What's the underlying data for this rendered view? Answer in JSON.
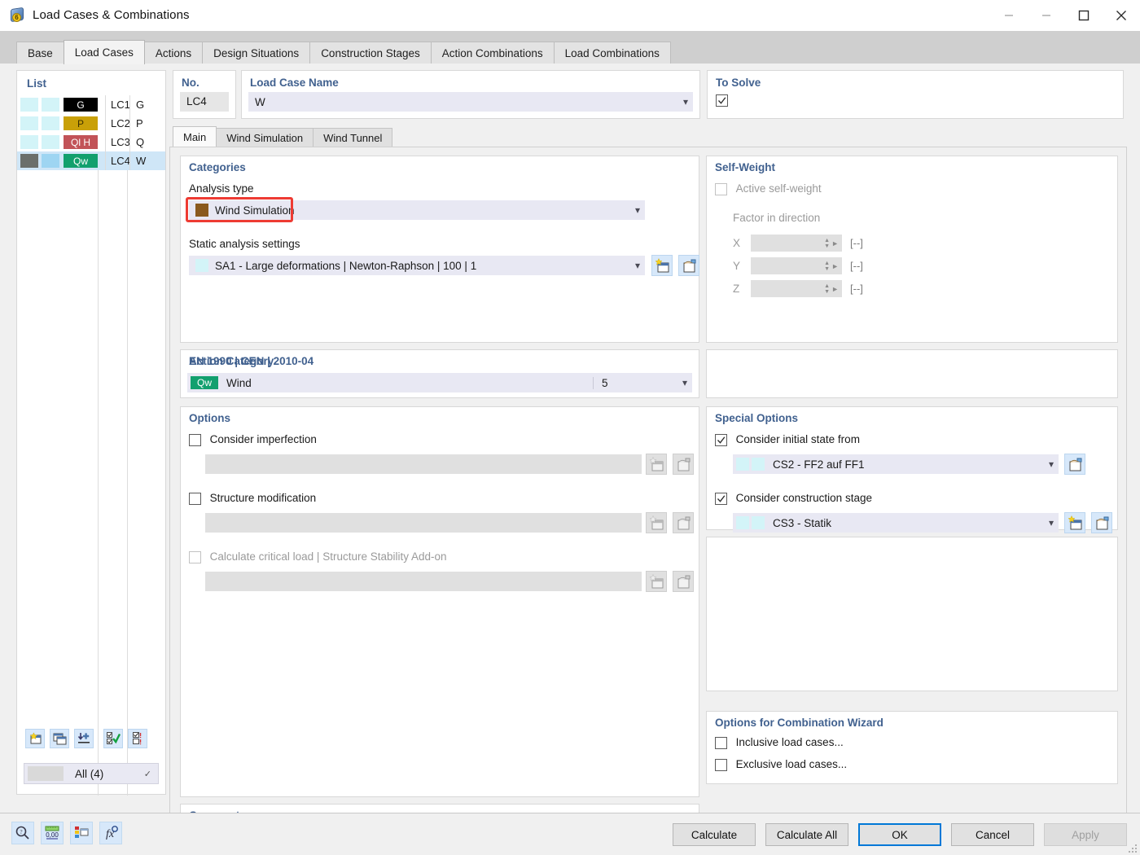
{
  "window": {
    "title": "Load Cases & Combinations",
    "icon": "app-cube-icon",
    "controls": {
      "restore_down": "minimize-icon",
      "minimize": "minimize-icon",
      "maximize": "maximize-icon",
      "close": "close-icon"
    }
  },
  "tabs": [
    {
      "label": "Base",
      "active": false
    },
    {
      "label": "Load Cases",
      "active": true
    },
    {
      "label": "Actions",
      "active": false
    },
    {
      "label": "Design Situations",
      "active": false
    },
    {
      "label": "Construction Stages",
      "active": false
    },
    {
      "label": "Action Combinations",
      "active": false
    },
    {
      "label": "Load Combinations",
      "active": false
    }
  ],
  "list": {
    "title": "List",
    "rows": [
      {
        "badge": "G",
        "badge_color": "#000000",
        "no": "LC1",
        "name": "G",
        "selected": false
      },
      {
        "badge": "P",
        "badge_color": "#c9a008",
        "no": "LC2",
        "name": "P",
        "selected": false
      },
      {
        "badge": "Ql H",
        "badge_color": "#c25358",
        "no": "LC3",
        "name": "Q",
        "selected": false
      },
      {
        "badge": "Qw",
        "badge_color": "#12a06e",
        "no": "LC4",
        "name": "W",
        "selected": true
      }
    ],
    "toolbar": [
      "new-load-case-icon",
      "copy-load-case-icon",
      "insert-load-case-icon",
      "select-all-icon",
      "deselect-all-icon"
    ],
    "footer": {
      "label": "All (4)",
      "caret": "edit-caret-icon"
    }
  },
  "header_fields": {
    "no_label": "No.",
    "no_value": "LC4",
    "name_label": "Load Case Name",
    "name_value": "W",
    "to_solve_label": "To Solve",
    "to_solve_checked": true
  },
  "inner_tabs": [
    {
      "label": "Main",
      "active": true
    },
    {
      "label": "Wind Simulation",
      "active": false
    },
    {
      "label": "Wind Tunnel",
      "active": false
    }
  ],
  "categories": {
    "title": "Categories",
    "analysis_type_label": "Analysis type",
    "analysis_type_value": "Wind Simulation",
    "analysis_type_swatch": "#8a5a1e",
    "analysis_type_highlighted": true,
    "static_settings_label": "Static analysis settings",
    "static_settings_value": "SA1 - Large deformations | Newton-Raphson | 100 | 1",
    "static_settings_swatch": "#d3f4f8",
    "static_settings_buttons": [
      "new-settings-icon",
      "edit-settings-icon"
    ]
  },
  "action_category": {
    "title": "Action Category",
    "standard": "EN 1990 | CEN | 2010-04",
    "badge": "Qw",
    "badge_color": "#12a06e",
    "value": "Wind",
    "number": "5"
  },
  "options": {
    "title": "Options",
    "items": [
      {
        "label": "Consider imperfection",
        "checked": false,
        "disabled": false,
        "field_value": "",
        "buttons": [
          "new-imperfection-icon",
          "edit-imperfection-icon"
        ]
      },
      {
        "label": "Structure modification",
        "checked": false,
        "disabled": false,
        "field_value": "",
        "buttons": [
          "new-modification-icon",
          "edit-modification-icon"
        ]
      },
      {
        "label": "Calculate critical load | Structure Stability Add-on",
        "checked": false,
        "disabled": true,
        "field_value": "",
        "buttons": [
          "new-stability-icon",
          "edit-stability-icon"
        ]
      }
    ]
  },
  "comment": {
    "title": "Comment",
    "value": "",
    "button": "comment-library-icon"
  },
  "self_weight": {
    "title": "Self-Weight",
    "active_label": "Active self-weight",
    "active_checked": false,
    "factor_label": "Factor in direction",
    "directions": [
      {
        "axis": "X",
        "value": "",
        "unit": "[--]"
      },
      {
        "axis": "Y",
        "value": "",
        "unit": "[--]"
      },
      {
        "axis": "Z",
        "value": "",
        "unit": "[--]"
      }
    ]
  },
  "special_options": {
    "title": "Special Options",
    "initial_state": {
      "label": "Consider initial state from",
      "checked": true,
      "value": "CS2 - FF2 auf FF1",
      "buttons": [
        "edit-initial-state-icon"
      ]
    },
    "construction_stage": {
      "label": "Consider construction stage",
      "checked": true,
      "value": "CS3 - Statik",
      "buttons": [
        "new-construction-stage-icon",
        "edit-construction-stage-icon"
      ]
    }
  },
  "combination_wizard": {
    "title": "Options for Combination Wizard",
    "items": [
      {
        "label": "Inclusive load cases...",
        "checked": false
      },
      {
        "label": "Exclusive load cases...",
        "checked": false
      }
    ]
  },
  "footer": {
    "tools": [
      "help-search-icon",
      "units-icon",
      "display-properties-icon",
      "formula-icon"
    ],
    "buttons": [
      {
        "label": "Calculate",
        "style": "normal"
      },
      {
        "label": "Calculate All",
        "style": "normal"
      },
      {
        "label": "OK",
        "style": "primary"
      },
      {
        "label": "Cancel",
        "style": "normal"
      },
      {
        "label": "Apply",
        "style": "disabled"
      }
    ]
  },
  "colors": {
    "accent_blue": "#0078d7",
    "section_heading": "#41618f",
    "highlight_red": "#ee3b33",
    "selection_blue": "#cfe6f7"
  }
}
